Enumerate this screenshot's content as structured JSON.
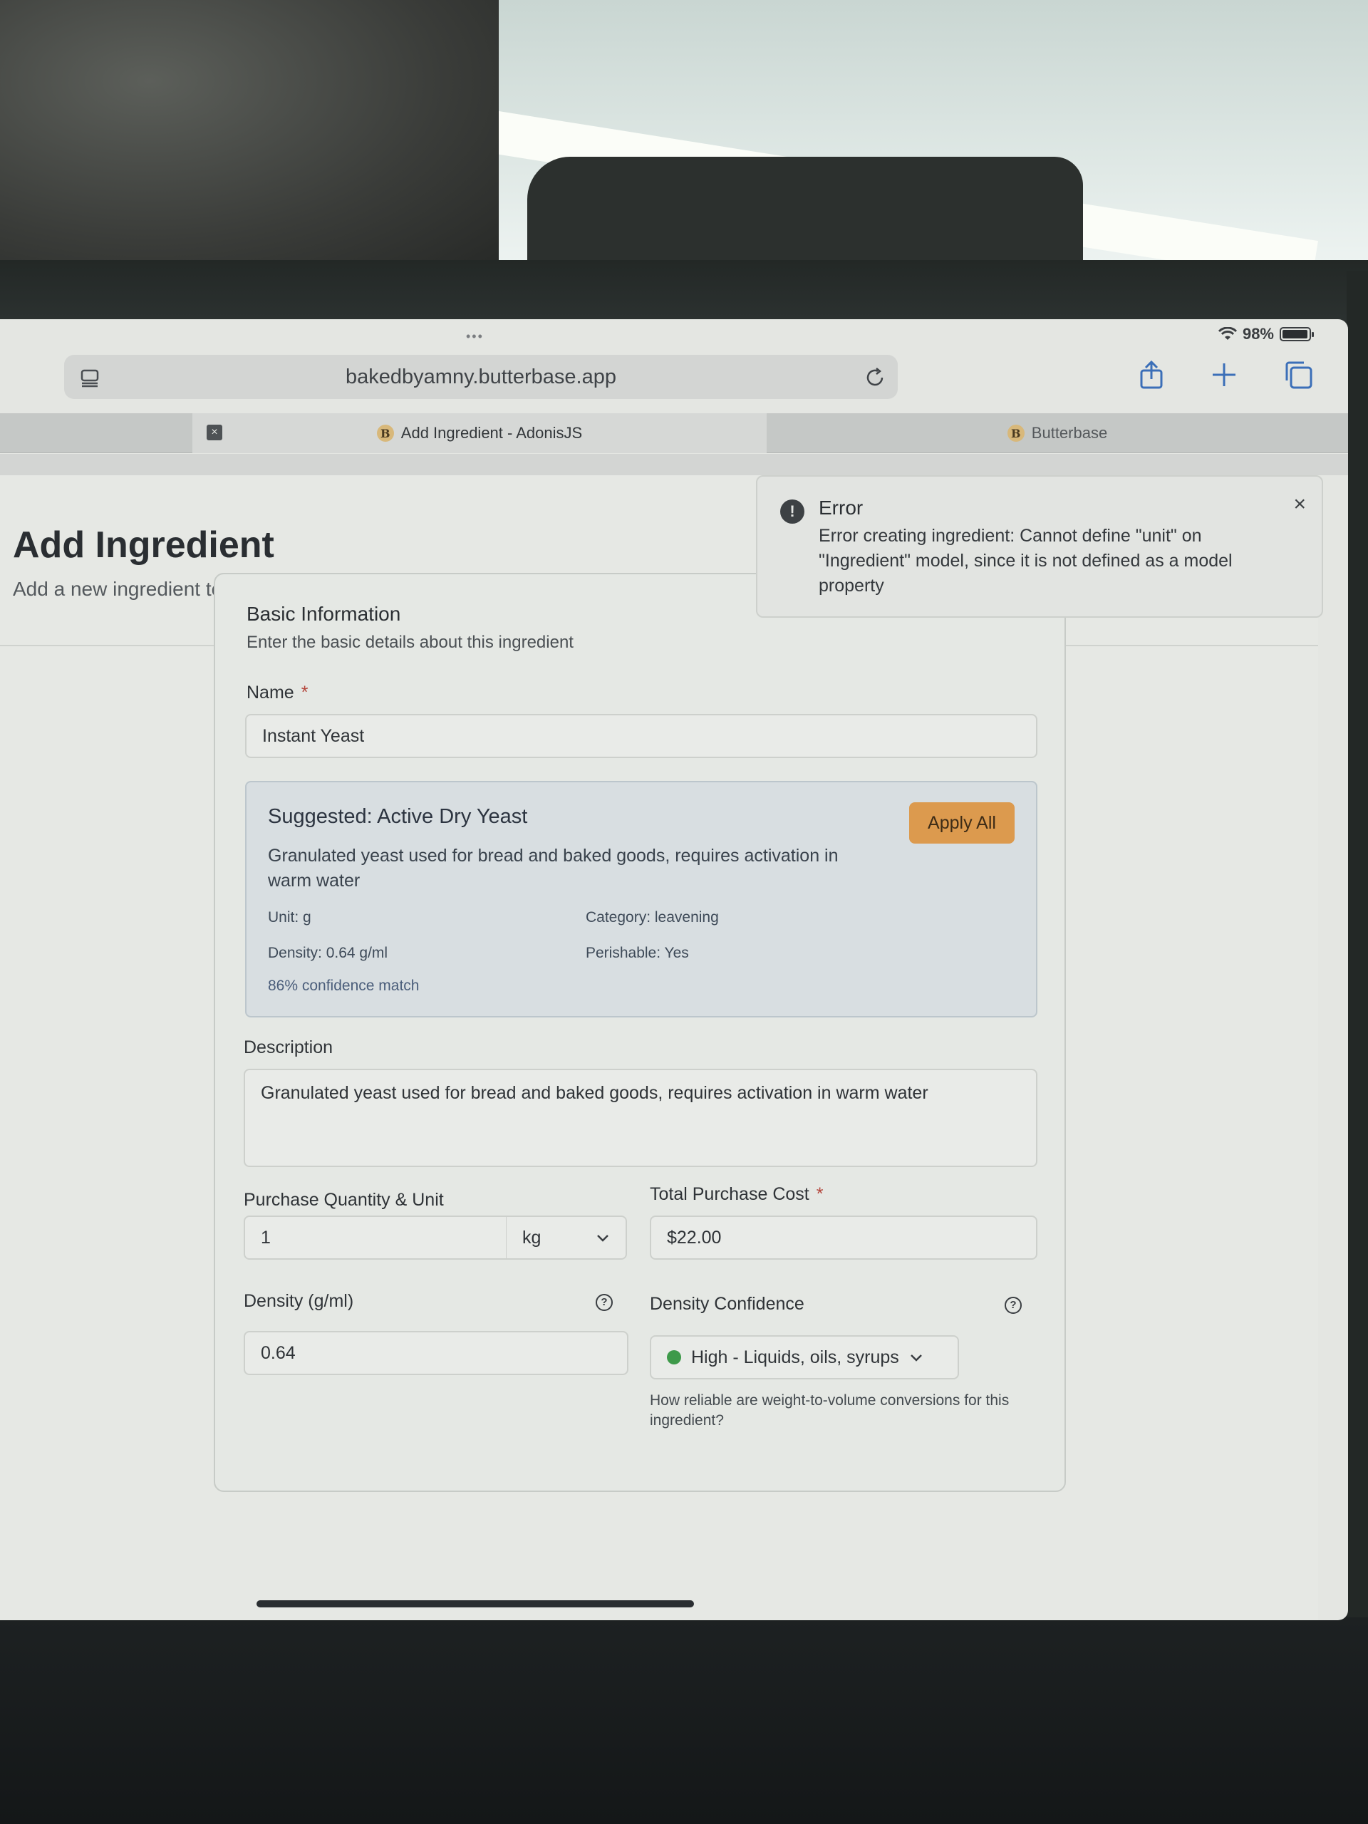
{
  "status": {
    "battery_text": "98%",
    "battery_level": 0.98
  },
  "browser": {
    "url": "bakedbyamny.butterbase.app",
    "tabs": [
      {
        "label": "Add Ingredient - AdonisJS",
        "active": true
      },
      {
        "label": "Butterbase",
        "active": false
      }
    ],
    "favicon_glyph": "B"
  },
  "page": {
    "title": "Add Ingredient",
    "subtitle": "Add a new ingredient to your inventory"
  },
  "toast": {
    "title": "Error",
    "message": "Error creating ingredient: Cannot define \"unit\" on \"Ingredient\" model, since it is not defined as a model property",
    "icon_glyph": "!",
    "close_glyph": "×"
  },
  "form": {
    "section_title": "Basic Information",
    "section_desc": "Enter the basic details about this ingredient",
    "name_label": "Name",
    "required_mark": "*",
    "name_value": "Instant Yeast",
    "suggestion": {
      "title": "Suggested: Active Dry Yeast",
      "apply_label": "Apply All",
      "description": "Granulated yeast used for bread and baked goods, requires activation in warm water",
      "unit": "Unit: g",
      "category": "Category: leavening",
      "density": "Density: 0.64 g/ml",
      "perishable": "Perishable: Yes",
      "confidence": "86% confidence match"
    },
    "description_label": "Description",
    "description_value": "Granulated yeast used for bread and baked goods, requires activation in warm water",
    "purchase_label": "Purchase Quantity & Unit",
    "quantity_value": "1",
    "unit_value": "kg",
    "cost_label": "Total Purchase Cost",
    "cost_value": "$22.00",
    "density_label": "Density (g/ml)",
    "density_value": "0.64",
    "density_conf_label": "Density Confidence",
    "density_conf_value": "High - Liquids, oils, syrups",
    "density_conf_hint": "How reliable are weight-to-volume conversions for this ingredient?",
    "help_glyph": "?"
  },
  "colors": {
    "accent": "#dc9a4e",
    "success": "#3e9a4a",
    "danger": "#b4473d"
  },
  "icons": [
    "sidebar-icon",
    "reload-icon",
    "share-icon",
    "plus-icon",
    "tabs-icon",
    "wifi-icon",
    "battery-icon",
    "alert-icon",
    "close-icon",
    "help-icon",
    "chevron-down-icon"
  ]
}
